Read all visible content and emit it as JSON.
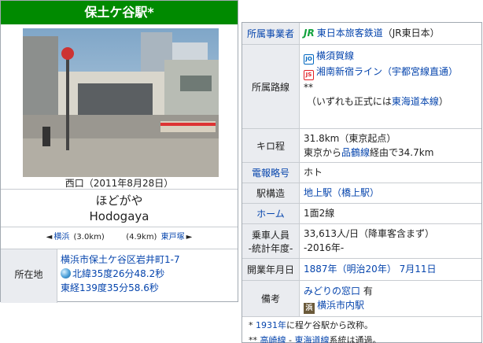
{
  "title": "保土ケ谷駅*",
  "photo": {
    "caption": "西口（2011年8月28日）"
  },
  "name": {
    "reading": "ほどがや",
    "romaji": "Hodogaya"
  },
  "adjacent": {
    "prev_arrow": "◄",
    "prev_name": "横浜",
    "prev_distance": "(3.0km)",
    "next_distance": "(4.9km)",
    "next_name": "東戸塚",
    "next_arrow": "►"
  },
  "address": {
    "label": "所在地",
    "line1": "横浜市保土ケ谷区岩井町1-7",
    "lat": "北緯35度26分48.2秒",
    "lon": "東経139度35分58.6秒"
  },
  "info": {
    "operator": {
      "label": "所属事業者",
      "logo": "JR",
      "value": "東日本旅客鉄道",
      "suffix": "（JR東日本）"
    },
    "lines": {
      "label": "所属路線",
      "line1_badge": "JO",
      "line1": "横須賀線",
      "line2_badge": "JS",
      "line2": "湘南新宿ライン",
      "line2_suffix": "（宇都宮線直通）",
      "note_mark": "**",
      "note_prefix": "（いずれも正式には",
      "note_link": "東海道本線",
      "note_suffix": "）"
    },
    "km": {
      "label": "キロ程",
      "line1": "31.8km（東京起点）",
      "line2_prefix": "東京から",
      "line2_link": "品鶴線",
      "line2_suffix": "経由で34.7km"
    },
    "code": {
      "label": "電報略号",
      "value": "ホト"
    },
    "structure": {
      "label": "駅構造",
      "value": "地上駅（橋上駅）"
    },
    "platform": {
      "label": "ホーム",
      "value": "1面2線"
    },
    "passengers": {
      "label1": "乗車人員",
      "label2": "-統計年度-",
      "value1": "33,613人/日（降車客含まず）",
      "value2": "-2016年-"
    },
    "opened": {
      "label": "開業年月日",
      "v1": "1887年",
      "v2": "（明治20年）",
      "v3": "7月11日"
    },
    "remarks": {
      "label": "備考",
      "v1_link": "みどりの窓口",
      "v1_suffix": " 有",
      "logo": "浜",
      "v2": "横浜市内駅"
    }
  },
  "notes": {
    "n1_mark": "* ",
    "n1_link": "1931年",
    "n1_text": "に程ケ谷駅から改称。",
    "n2_mark": "** ",
    "n2_link1": "高崎線",
    "n2_sep": " - ",
    "n2_link2": "東海道線",
    "n2_text": "系統は通過。"
  }
}
